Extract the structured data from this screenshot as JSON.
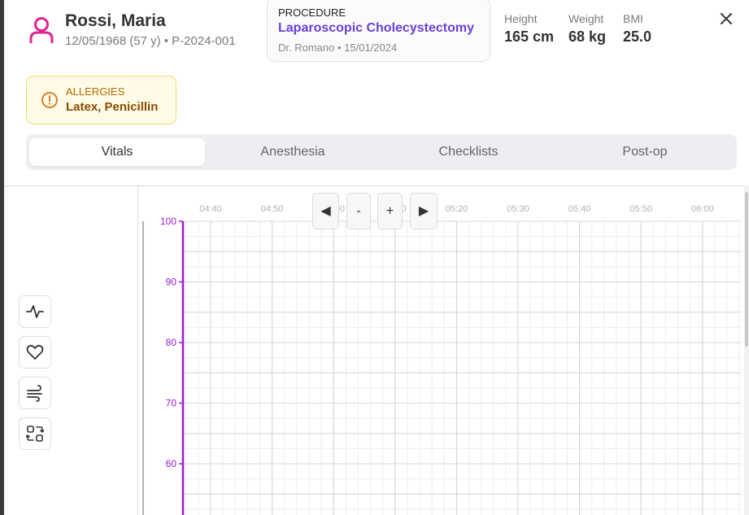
{
  "patient": {
    "name": "Rossi, Maria",
    "meta": "12/05/1968 (57 y) • P-2024-001"
  },
  "procedure": {
    "label": "PROCEDURE",
    "name": "Laparoscopic Cholecystectomy",
    "detail": "Dr. Romano • 15/01/2024"
  },
  "measures": [
    {
      "label": "Height",
      "value": "165 cm"
    },
    {
      "label": "Weight",
      "value": "68 kg"
    },
    {
      "label": "BMI",
      "value": "25.0"
    }
  ],
  "allergies": {
    "label": "ALLERGIES",
    "value": "Latex, Penicillin"
  },
  "tabs": [
    {
      "label": "Vitals",
      "active": true
    },
    {
      "label": "Anesthesia",
      "active": false
    },
    {
      "label": "Checklists",
      "active": false
    },
    {
      "label": "Post-op",
      "active": false
    }
  ],
  "side_tools": [
    "activity-icon",
    "heart-icon",
    "wind-icon",
    "swap-icon"
  ],
  "chart_controls": {
    "prev": "◀",
    "zoom_out": "-",
    "zoom_in": "+",
    "next": "▶"
  },
  "chart_data": {
    "type": "line",
    "x_ticks": [
      "04:40",
      "04:50",
      "05:00",
      "05:10",
      "05:20",
      "05:30",
      "05:40",
      "05:50",
      "06:00"
    ],
    "y_ticks": [
      100,
      90,
      80,
      70,
      60
    ],
    "series": []
  },
  "colors": {
    "accent": "#6a3fd6",
    "avatar": "#e0248f",
    "axis": "#9b1fd0",
    "allergy_bg": "#fffbe6"
  }
}
